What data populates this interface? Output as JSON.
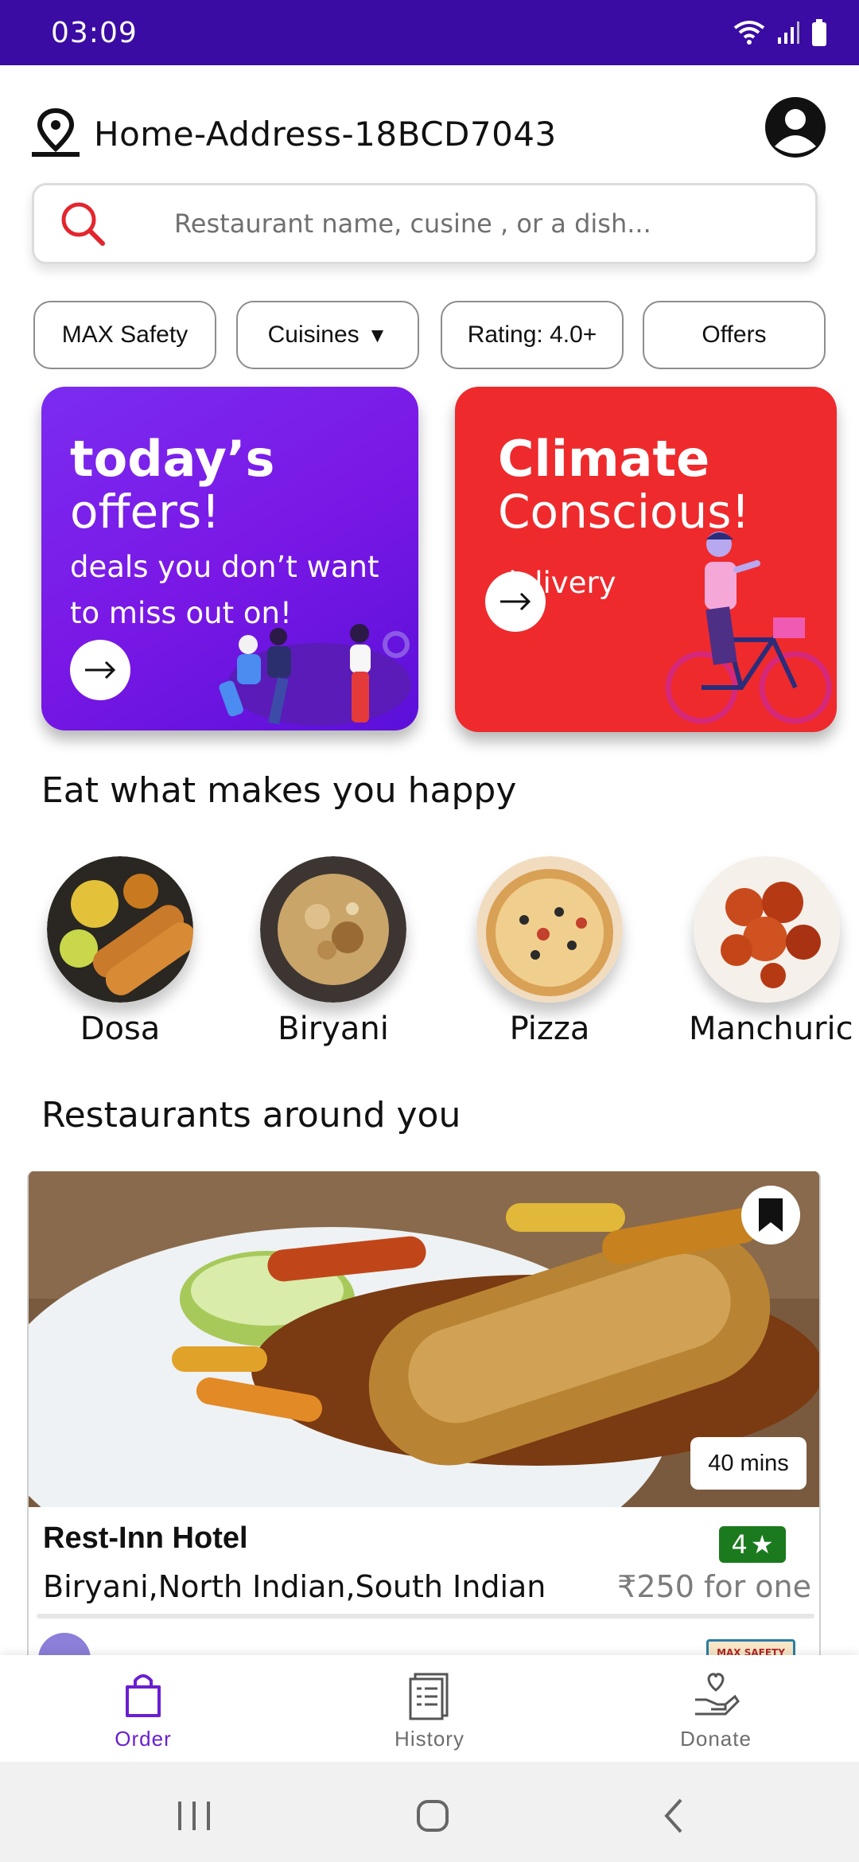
{
  "status_bar": {
    "time": "03:09"
  },
  "header": {
    "address": "Home-Address-18BCD7043"
  },
  "search": {
    "placeholder": "Restaurant name, cusine , or a dish..."
  },
  "filters": [
    {
      "label": "MAX Safety"
    },
    {
      "label": "Cuisines",
      "icon": "caret-down-icon"
    },
    {
      "label": "Rating: 4.0+"
    },
    {
      "label": "Offers"
    }
  ],
  "banners": [
    {
      "title": "today’s",
      "subtitle": "offers!",
      "line1": "deals you don’t want",
      "line2": "to miss out on!",
      "color": "#7b2cf0"
    },
    {
      "title": "Climate",
      "subtitle": "Conscious!",
      "line1": "delivery",
      "color": "#ee2a2d"
    }
  ],
  "sections": {
    "happy": "Eat what makes you happy",
    "restaurants": "Restaurants around you"
  },
  "categories": [
    {
      "label": "Dosa"
    },
    {
      "label": "Biryani"
    },
    {
      "label": "Pizza"
    },
    {
      "label": "Manchuric"
    }
  ],
  "restaurant": {
    "name": "Rest-Inn Hotel",
    "rating": "4",
    "cuisines": "Biryani,North Indian,South Indian",
    "price": "₹250 for one",
    "delivery_time": "40 mins",
    "safety_badge": "MAX SAFETY"
  },
  "bottom_nav": [
    {
      "label": "Order",
      "icon": "shopping-bag-icon",
      "active": true
    },
    {
      "label": "History",
      "icon": "receipt-list-icon",
      "active": false
    },
    {
      "label": "Donate",
      "icon": "heart-hand-icon",
      "active": false
    }
  ],
  "colors": {
    "status_bar": "#3a0ca3",
    "accent": "#6a1fd0",
    "search_icon": "#e3262e",
    "rating_green": "#1b7a1e"
  }
}
